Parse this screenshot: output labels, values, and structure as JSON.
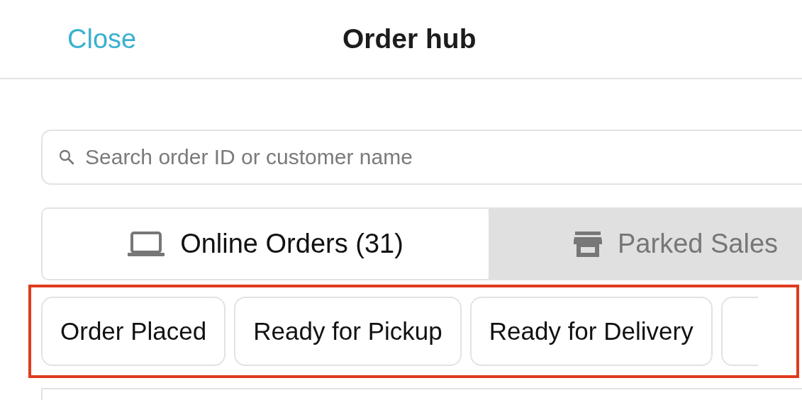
{
  "header": {
    "close": "Close",
    "title": "Order hub"
  },
  "search": {
    "placeholder": "Search order ID or customer name"
  },
  "tabs": [
    {
      "label": "Online Orders (31)",
      "kind": "online",
      "selected": true
    },
    {
      "label": "Parked Sales",
      "kind": "parked",
      "selected": false
    }
  ],
  "filters": {
    "highlighted": true,
    "items": [
      {
        "kind": "chip",
        "label": "Order Placed"
      },
      {
        "kind": "chip",
        "label": "Ready for Pickup"
      },
      {
        "kind": "chip",
        "label": "Ready for Delivery"
      },
      {
        "kind": "partial"
      }
    ]
  }
}
